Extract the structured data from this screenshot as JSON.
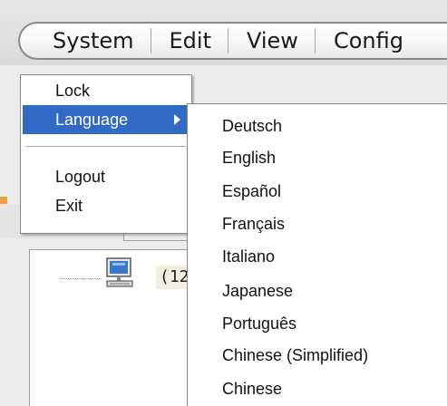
{
  "menubar": {
    "items": [
      {
        "label": "System"
      },
      {
        "label": "Edit"
      },
      {
        "label": "View"
      },
      {
        "label": "Config"
      }
    ]
  },
  "system_menu": {
    "items": [
      {
        "label": "Lock"
      },
      {
        "label": "Language"
      },
      {
        "label": "Logout"
      },
      {
        "label": "Exit"
      }
    ],
    "selected": "Language"
  },
  "language_menu": {
    "items": [
      {
        "label": "Deutsch"
      },
      {
        "label": "English"
      },
      {
        "label": "Español"
      },
      {
        "label": "Français"
      },
      {
        "label": "Italiano"
      },
      {
        "label": "Japanese"
      },
      {
        "label": "Português"
      },
      {
        "label": "Chinese (Simplified)"
      },
      {
        "label": "Chinese"
      }
    ]
  },
  "tree": {
    "node_label": "(12"
  },
  "colors": {
    "selection": "#316ac5",
    "accent_orange": "#f0a040"
  },
  "icons": {
    "tree_node": "computer-monitor-icon",
    "submenu_arrow": "triangle-right-icon"
  }
}
